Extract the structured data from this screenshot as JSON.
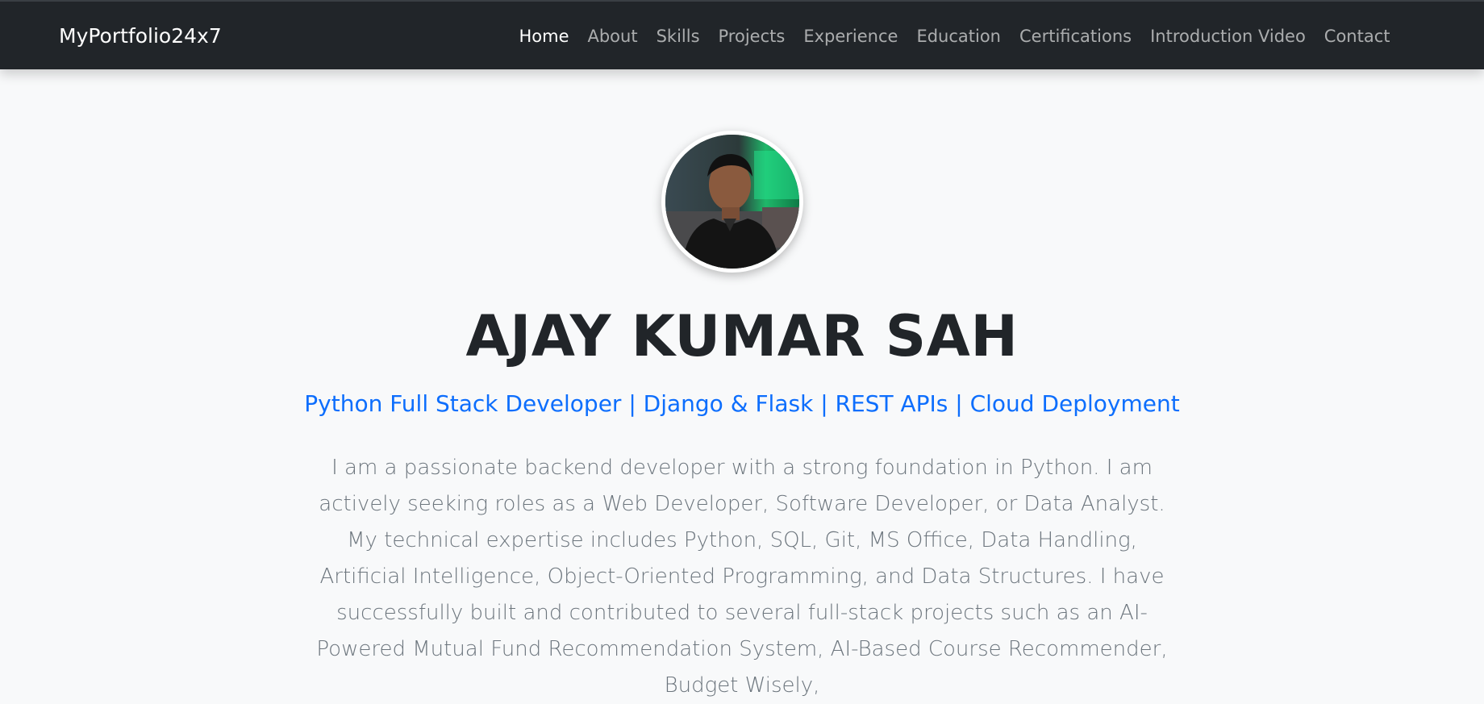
{
  "navbar": {
    "brand": "MyPortfolio24x7",
    "links": [
      {
        "label": "Home"
      },
      {
        "label": "About"
      },
      {
        "label": "Skills"
      },
      {
        "label": "Projects"
      },
      {
        "label": "Experience"
      },
      {
        "label": "Education"
      },
      {
        "label": "Certifications"
      },
      {
        "label": "Introduction Video"
      },
      {
        "label": "Contact"
      }
    ]
  },
  "hero": {
    "name": "AJAY KUMAR SAH",
    "tagline": "Python Full Stack Developer | Django & Flask | REST APIs | Cloud Deployment",
    "bio": "I am a passionate backend developer with a strong foundation in Python. I am actively seeking roles as a Web Developer, Software Developer, or Data Analyst. My technical expertise includes Python, SQL, Git, MS Office, Data Handling, Artificial Intelligence, Object-Oriented Programming, and Data Structures. I have successfully built and contributed to several full-stack projects such as an AI-Powered Mutual Fund Recommendation System, AI-Based Course Recommender, Budget Wisely,"
  },
  "colors": {
    "navbar_bg": "#212529",
    "page_bg": "#f8f9fa",
    "accent": "#0d6efd",
    "heading": "#212529",
    "body_text": "#6c757d"
  }
}
